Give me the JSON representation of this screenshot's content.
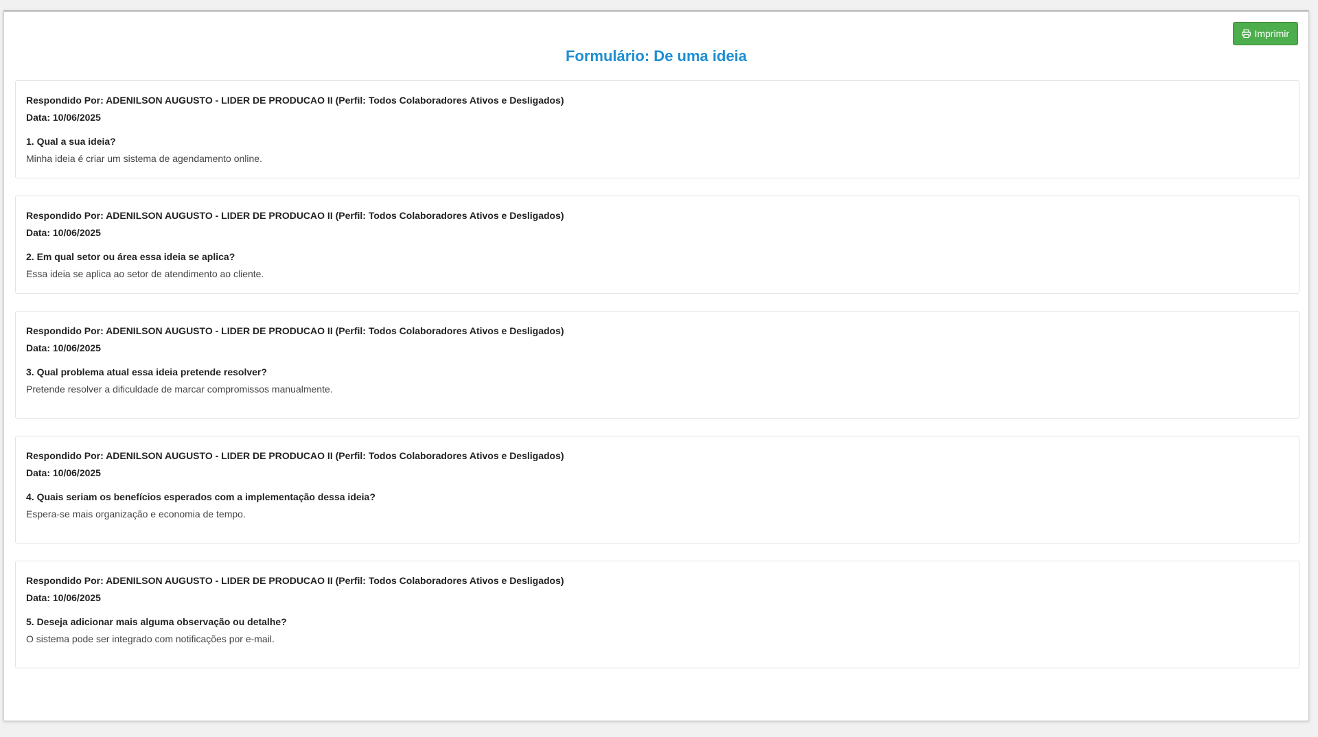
{
  "page": {
    "title": "Formulário: De uma ideia",
    "print_button": "Imprimir",
    "print_icon": "print-icon"
  },
  "colors": {
    "title": "#1f8fd1",
    "print_button": "#4cae4c"
  },
  "responses": [
    {
      "respondent": "Respondido Por: ADENILSON AUGUSTO - LIDER DE PRODUCAO II (Perfil: Todos Colaboradores Ativos e Desligados)",
      "date": "Data: 10/06/2025",
      "question": "1. Qual a sua ideia?",
      "answer": "Minha ideia é criar um sistema de agendamento online."
    },
    {
      "respondent": "Respondido Por: ADENILSON AUGUSTO - LIDER DE PRODUCAO II (Perfil: Todos Colaboradores Ativos e Desligados)",
      "date": "Data: 10/06/2025",
      "question": "2. Em qual setor ou área essa ideia se aplica?",
      "answer": "Essa ideia se aplica ao setor de atendimento ao cliente."
    },
    {
      "respondent": "Respondido Por: ADENILSON AUGUSTO - LIDER DE PRODUCAO II (Perfil: Todos Colaboradores Ativos e Desligados)",
      "date": "Data: 10/06/2025",
      "question": "3. Qual problema atual essa ideia pretende resolver?",
      "answer": "Pretende resolver a dificuldade de marcar compromissos manualmente."
    },
    {
      "respondent": "Respondido Por: ADENILSON AUGUSTO - LIDER DE PRODUCAO II (Perfil: Todos Colaboradores Ativos e Desligados)",
      "date": "Data: 10/06/2025",
      "question": "4. Quais seriam os benefícios esperados com a implementação dessa ideia?",
      "answer": "Espera-se mais organização e economia de tempo."
    },
    {
      "respondent": "Respondido Por: ADENILSON AUGUSTO - LIDER DE PRODUCAO II (Perfil: Todos Colaboradores Ativos e Desligados)",
      "date": "Data: 10/06/2025",
      "question": "5. Deseja adicionar mais alguma observação ou detalhe?",
      "answer": "O sistema pode ser integrado com notificações por e-mail."
    }
  ]
}
